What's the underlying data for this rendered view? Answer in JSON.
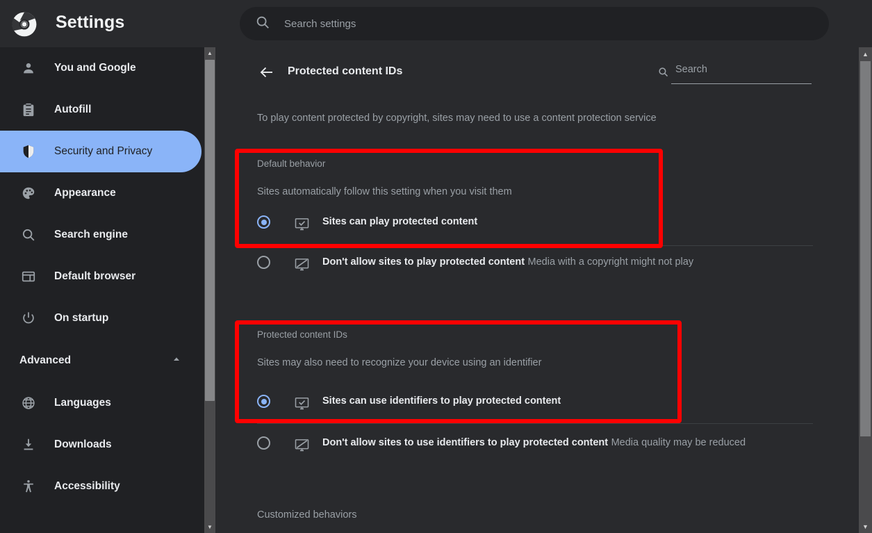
{
  "topbar": {
    "logo_icon": "chrome-logo-icon",
    "title": "Settings",
    "search_icon": "search-icon",
    "search_placeholder": "Search settings",
    "search_value": ""
  },
  "sidebar": {
    "items": [
      {
        "label": "You and Google",
        "icon": "person-icon",
        "selected": false
      },
      {
        "label": "Autofill",
        "icon": "clipboard-icon",
        "selected": false
      },
      {
        "label": "Security and Privacy",
        "icon": "shield-icon",
        "selected": true
      },
      {
        "label": "Appearance",
        "icon": "palette-icon",
        "selected": false
      },
      {
        "label": "Search engine",
        "icon": "magnifier-icon",
        "selected": false
      },
      {
        "label": "Default browser",
        "icon": "browser-window-icon",
        "selected": false
      },
      {
        "label": "On startup",
        "icon": "power-icon",
        "selected": false
      }
    ],
    "advanced": {
      "label": "Advanced",
      "caret_icon": "chevron-up-icon",
      "expanded": true
    },
    "advanced_items": [
      {
        "label": "Languages",
        "icon": "globe-icon"
      },
      {
        "label": "Downloads",
        "icon": "download-icon"
      },
      {
        "label": "Accessibility",
        "icon": "accessibility-icon"
      }
    ]
  },
  "page": {
    "back_icon": "back-arrow-icon",
    "title": "Protected content IDs",
    "search_icon": "search-icon",
    "search_placeholder": "Search",
    "search_value": "",
    "description": "To play content protected by copyright, sites may need to use a content protection service"
  },
  "default_behavior": {
    "title": "Default behavior",
    "subtitle": "Sites automatically follow this setting when you visit them",
    "options": [
      {
        "label": "Sites can play protected content",
        "sublabel": "",
        "icon": "monitor-check-icon",
        "selected": true
      },
      {
        "label": "Don't allow sites to play protected content",
        "sublabel": "Media with a copyright might not play",
        "icon": "monitor-off-icon",
        "selected": false
      }
    ]
  },
  "protected_content_ids": {
    "title": "Protected content IDs",
    "subtitle": "Sites may also need to recognize your device using an identifier",
    "options": [
      {
        "label": "Sites can use identifiers to play protected content",
        "sublabel": "",
        "icon": "monitor-check-icon",
        "selected": true
      },
      {
        "label": "Don't allow sites to use identifiers to play protected content",
        "sublabel": "Media quality may be reduced",
        "icon": "monitor-off-icon",
        "selected": false
      }
    ]
  },
  "customized_behaviors": {
    "title": "Customized behaviors"
  },
  "annotations": {
    "highlight_color": "#ff0000",
    "boxes": [
      {
        "name": "default-behavior-highlight"
      },
      {
        "name": "protected-content-ids-highlight"
      }
    ]
  },
  "scrollbars": {
    "sidebar": {
      "up_icon": "scroll-up-arrow-icon",
      "down_icon": "scroll-down-arrow-icon"
    },
    "main": {
      "up_icon": "scroll-up-arrow-icon",
      "down_icon": "scroll-down-arrow-icon"
    }
  }
}
